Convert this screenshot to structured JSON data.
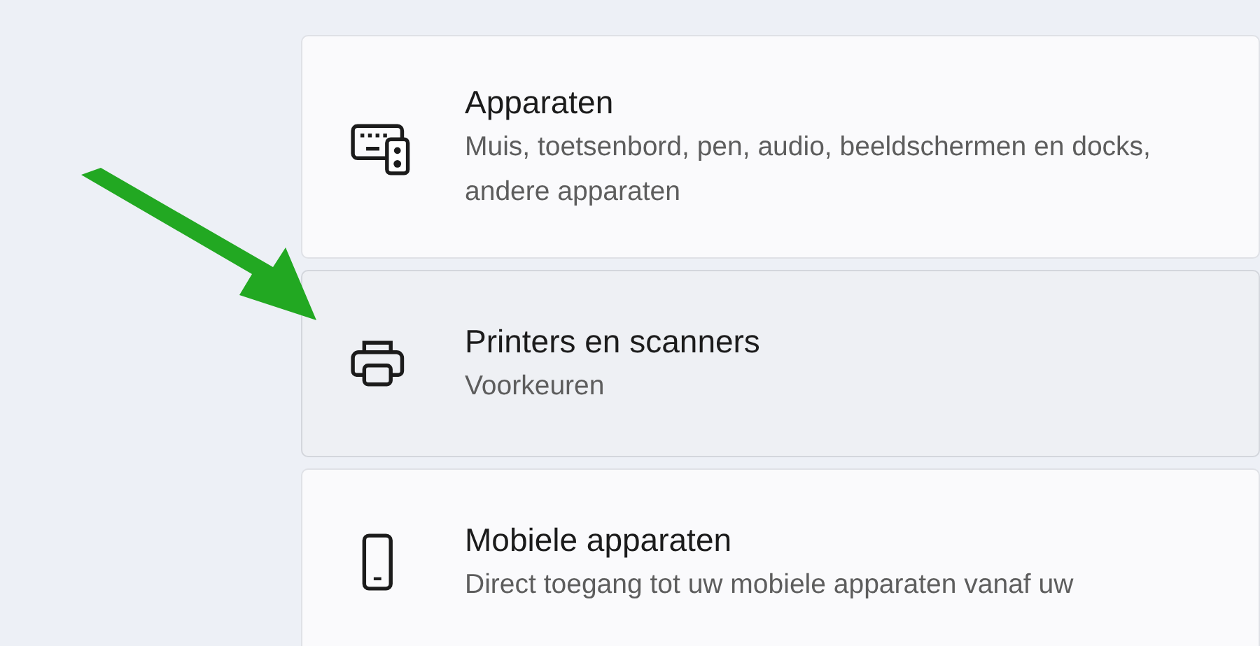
{
  "cards": [
    {
      "kind": "devices",
      "title": "Apparaten",
      "subtitle": "Muis, toetsenbord, pen, audio, beeldschermen en docks, andere apparaten",
      "hovered": false
    },
    {
      "kind": "printer",
      "title": "Printers en scanners",
      "subtitle": "Voorkeuren",
      "hovered": true
    },
    {
      "kind": "phone",
      "title": "Mobiele apparaten",
      "subtitle": "Direct toegang tot uw mobiele apparaten vanaf uw",
      "hovered": false
    }
  ]
}
